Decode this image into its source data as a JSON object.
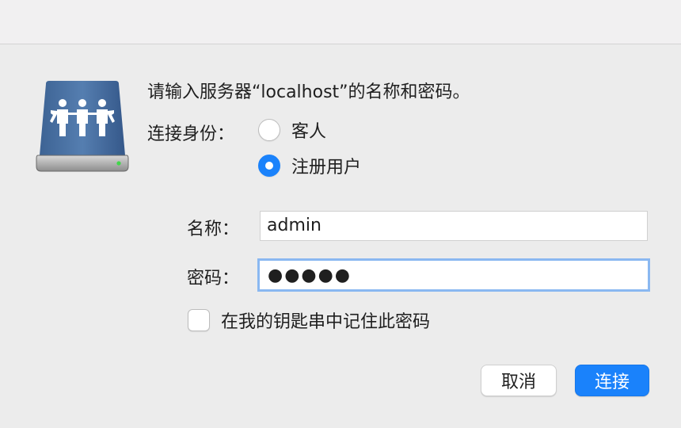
{
  "dialog": {
    "message": "请输入服务器“localhost”的名称和密码。",
    "connect_as_label": "连接身份：",
    "options": {
      "guest": {
        "label": "客人",
        "selected": false
      },
      "registered": {
        "label": "注册用户",
        "selected": true
      }
    },
    "name_label": "名称：",
    "name_value": "admin",
    "password_label": "密码：",
    "password_masked": "●●●●●",
    "remember_label": "在我的钥匙串中记住此密码",
    "remember_checked": false,
    "cancel_label": "取消",
    "connect_label": "连接",
    "icon": "shared-server-drive-icon",
    "colors": {
      "accent": "#1a82fb",
      "focus_ring": "#8ab8f1",
      "background": "#ececec"
    }
  }
}
